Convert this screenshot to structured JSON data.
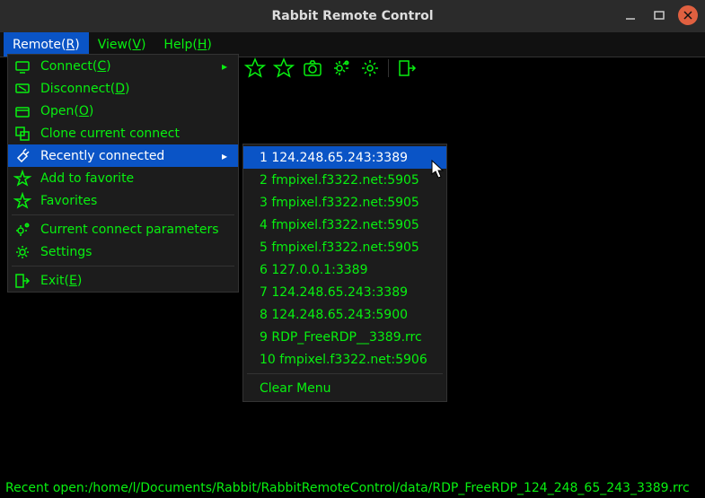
{
  "title": "Rabbit Remote Control",
  "menubar": {
    "remote": "Remote(R)",
    "view": "View(V)",
    "help": "Help(H)"
  },
  "dropdown": {
    "connect": "Connect(C)",
    "disconnect": "Disconnect(D)",
    "open": "Open(O)",
    "clone": "Clone current connect",
    "recent": "Recently connected",
    "add_fav": "Add to favorite",
    "favorites": "Favorites",
    "params": "Current connect parameters",
    "settings": "Settings",
    "exit": "Exit(E)"
  },
  "recent_items": [
    "1 124.248.65.243:3389",
    "2 fmpixel.f3322.net:5905",
    "3 fmpixel.f3322.net:5905",
    "4 fmpixel.f3322.net:5905",
    "5 fmpixel.f3322.net:5905",
    "6 127.0.0.1:3389",
    "7 124.248.65.243:3389",
    "8 124.248.65.243:5900",
    "9 RDP_FreeRDP__3389.rrc",
    "10 fmpixel.f3322.net:5906"
  ],
  "clear_menu": "Clear Menu",
  "status": "Recent open:/home/l/Documents/Rabbit/RabbitRemoteControl/data/RDP_FreeRDP_124_248_65_243_3389.rrc"
}
